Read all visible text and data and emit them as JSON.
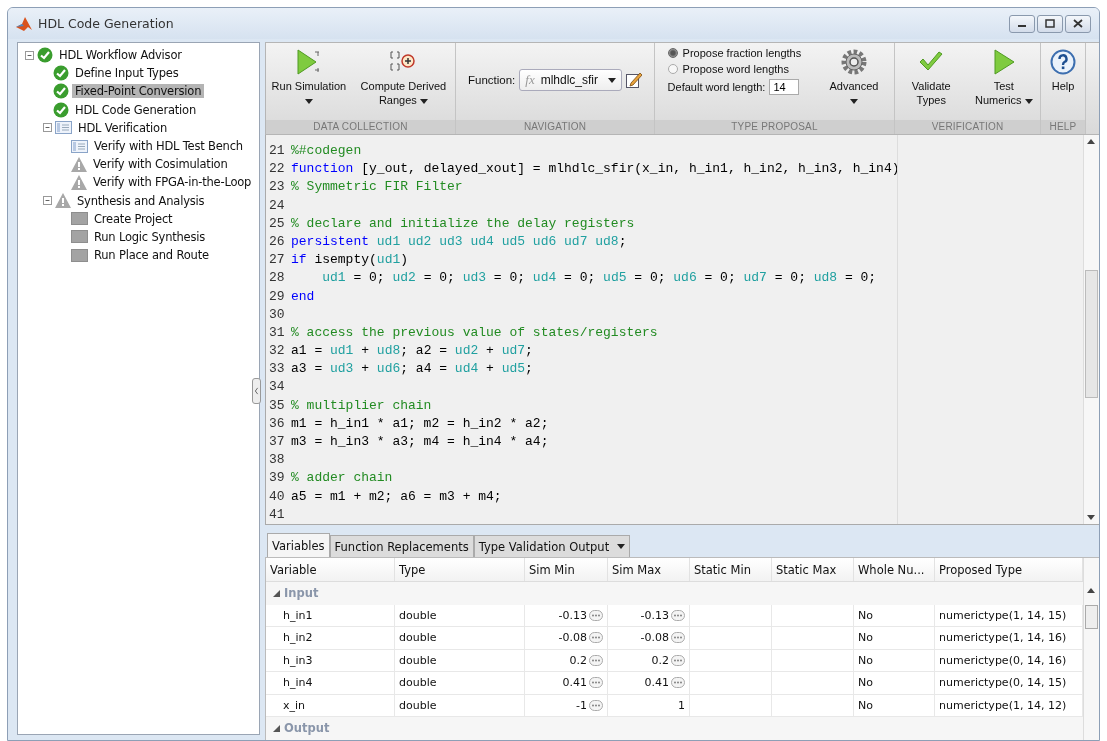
{
  "window": {
    "title": "HDL Code Generation"
  },
  "workflow_tree": [
    {
      "label": "HDL Workflow Advisor",
      "kind": "passed",
      "selected": false,
      "expanded": true,
      "children": [
        {
          "label": "Define Input Types",
          "kind": "passed",
          "selected": false
        },
        {
          "label": "Fixed-Point Conversion",
          "kind": "passed",
          "selected": true
        },
        {
          "label": "HDL Code Generation",
          "kind": "passed",
          "selected": false
        },
        {
          "label": "HDL Verification",
          "kind": "task-list",
          "selected": false,
          "expanded": true,
          "children": [
            {
              "label": "Verify with HDL Test Bench",
              "kind": "task-list",
              "selected": false
            },
            {
              "label": "Verify with Cosimulation",
              "kind": "warning",
              "selected": false
            },
            {
              "label": "Verify with FPGA-in-the-Loop",
              "kind": "warning",
              "selected": false
            }
          ]
        },
        {
          "label": "Synthesis and Analysis",
          "kind": "warning",
          "selected": false,
          "expanded": true,
          "children": [
            {
              "label": "Create Project",
              "kind": "not-run",
              "selected": false
            },
            {
              "label": "Run Logic Synthesis",
              "kind": "not-run",
              "selected": false
            },
            {
              "label": "Run Place and Route",
              "kind": "not-run",
              "selected": false
            }
          ]
        }
      ]
    }
  ],
  "toolstrip": {
    "sections": [
      {
        "kind": "buttons",
        "label": "DATA COLLECTION",
        "buttons": [
          {
            "label": "Run Simulation",
            "menu": true
          },
          {
            "label": "Compute Derived Ranges",
            "menu": true
          }
        ]
      },
      {
        "kind": "navigation",
        "label": "NAVIGATION",
        "field_label": "Function:",
        "prefix": "fx",
        "value": "mlhdlc_sfir"
      },
      {
        "kind": "type_proposal",
        "label": "TYPE PROPOSAL",
        "radios": [
          {
            "label": "Propose fraction lengths",
            "selected": true
          },
          {
            "label": "Propose word lengths",
            "selected": false
          }
        ],
        "field_label": "Default word length:",
        "value": "14",
        "buttons": [
          {
            "label": "Advanced",
            "menu": true
          }
        ]
      },
      {
        "kind": "buttons",
        "label": "VERIFICATION",
        "buttons": [
          {
            "label": "Validate Types",
            "menu": false
          },
          {
            "label": "Test Numerics",
            "menu": true
          }
        ]
      },
      {
        "kind": "buttons",
        "label": "HELP",
        "buttons": [
          {
            "label": "Help",
            "menu": false
          }
        ]
      }
    ]
  },
  "code": {
    "lines": [
      {
        "number": "21",
        "tokens": [
          {
            "kind": "comment",
            "text": "%#codegen"
          }
        ]
      },
      {
        "number": "22",
        "tokens": [
          {
            "kind": "keyword",
            "text": "function"
          },
          {
            "kind": "plain",
            "text": " [y_out, delayed_xout] = mlhdlc_sfir(x_in, h_in1, h_in2, h_in3, h_in4)"
          }
        ]
      },
      {
        "number": "23",
        "tokens": [
          {
            "kind": "comment",
            "text": "% Symmetric FIR Filter"
          }
        ]
      },
      {
        "number": "24"
      },
      {
        "number": "25",
        "tokens": [
          {
            "kind": "comment",
            "text": "% declare and initialize the delay registers"
          }
        ]
      },
      {
        "number": "26",
        "tokens": [
          {
            "kind": "keyword",
            "text": "persistent"
          },
          {
            "kind": "variable",
            "text": " ud1 ud2 ud3 ud4 ud5 ud6 ud7 ud8"
          },
          {
            "kind": "plain",
            "text": ";"
          }
        ]
      },
      {
        "number": "27",
        "tokens": [
          {
            "kind": "keyword",
            "text": "if"
          },
          {
            "kind": "plain",
            "text": " isempty("
          },
          {
            "kind": "variable",
            "text": "ud1"
          },
          {
            "kind": "plain",
            "text": ")"
          }
        ]
      },
      {
        "number": "28",
        "tokens": [
          {
            "kind": "variable",
            "text": "    ud1"
          },
          {
            "kind": "plain",
            "text": " = 0; "
          },
          {
            "kind": "variable",
            "text": "ud2"
          },
          {
            "kind": "plain",
            "text": " = 0; "
          },
          {
            "kind": "variable",
            "text": "ud3"
          },
          {
            "kind": "plain",
            "text": " = 0; "
          },
          {
            "kind": "variable",
            "text": "ud4"
          },
          {
            "kind": "plain",
            "text": " = 0; "
          },
          {
            "kind": "variable",
            "text": "ud5"
          },
          {
            "kind": "plain",
            "text": " = 0; "
          },
          {
            "kind": "variable",
            "text": "ud6"
          },
          {
            "kind": "plain",
            "text": " = 0; "
          },
          {
            "kind": "variable",
            "text": "ud7"
          },
          {
            "kind": "plain",
            "text": " = 0; "
          },
          {
            "kind": "variable",
            "text": "ud8"
          },
          {
            "kind": "plain",
            "text": " = 0;"
          }
        ]
      },
      {
        "number": "29",
        "tokens": [
          {
            "kind": "keyword",
            "text": "end"
          }
        ]
      },
      {
        "number": "30"
      },
      {
        "number": "31",
        "tokens": [
          {
            "kind": "comment",
            "text": "% access the previous value of states/registers"
          }
        ]
      },
      {
        "number": "32",
        "tokens": [
          {
            "kind": "plain",
            "text": "a1 = "
          },
          {
            "kind": "variable",
            "text": "ud1"
          },
          {
            "kind": "plain",
            "text": " + "
          },
          {
            "kind": "variable",
            "text": "ud8"
          },
          {
            "kind": "plain",
            "text": "; a2 = "
          },
          {
            "kind": "variable",
            "text": "ud2"
          },
          {
            "kind": "plain",
            "text": " + "
          },
          {
            "kind": "variable",
            "text": "ud7"
          },
          {
            "kind": "plain",
            "text": ";"
          }
        ]
      },
      {
        "number": "33",
        "tokens": [
          {
            "kind": "plain",
            "text": "a3 = "
          },
          {
            "kind": "variable",
            "text": "ud3"
          },
          {
            "kind": "plain",
            "text": " + "
          },
          {
            "kind": "variable",
            "text": "ud6"
          },
          {
            "kind": "plain",
            "text": "; a4 = "
          },
          {
            "kind": "variable",
            "text": "ud4"
          },
          {
            "kind": "plain",
            "text": " + "
          },
          {
            "kind": "variable",
            "text": "ud5"
          },
          {
            "kind": "plain",
            "text": ";"
          }
        ]
      },
      {
        "number": "34"
      },
      {
        "number": "35",
        "tokens": [
          {
            "kind": "comment",
            "text": "% multiplier chain"
          }
        ]
      },
      {
        "number": "36",
        "tokens": [
          {
            "kind": "plain",
            "text": "m1 = h_in1 * a1; m2 = h_in2 * a2;"
          }
        ]
      },
      {
        "number": "37",
        "tokens": [
          {
            "kind": "plain",
            "text": "m3 = h_in3 * a3; m4 = h_in4 * a4;"
          }
        ]
      },
      {
        "number": "38"
      },
      {
        "number": "39",
        "tokens": [
          {
            "kind": "comment",
            "text": "% adder chain"
          }
        ]
      },
      {
        "number": "40",
        "tokens": [
          {
            "kind": "plain",
            "text": "a5 = m1 + m2; a6 = m3 + m4;"
          }
        ]
      },
      {
        "number": "41"
      }
    ]
  },
  "variables_panel": {
    "tabs": [
      {
        "label": "Variables",
        "selected": true,
        "menu": false
      },
      {
        "label": "Function Replacements",
        "selected": false,
        "menu": false
      },
      {
        "label": "Type Validation Output",
        "selected": false,
        "menu": true
      }
    ],
    "columns": [
      "Variable",
      "Type",
      "Sim Min",
      "Sim Max",
      "Static Min",
      "Static Max",
      "Whole Nu...",
      "Proposed Type"
    ],
    "groups": [
      {
        "label": "Input",
        "expanded": true,
        "rows": [
          {
            "variable": "h_in1",
            "type": "double",
            "sim_min": "-0.13",
            "sim_min_editable": true,
            "sim_max": "-0.13",
            "sim_max_editable": true,
            "whole_number": "No",
            "proposed_type": "numerictype(1, 14, 15)"
          },
          {
            "variable": "h_in2",
            "type": "double",
            "sim_min": "-0.08",
            "sim_min_editable": true,
            "sim_max": "-0.08",
            "sim_max_editable": true,
            "whole_number": "No",
            "proposed_type": "numerictype(1, 14, 16)"
          },
          {
            "variable": "h_in3",
            "type": "double",
            "sim_min": "0.2",
            "sim_min_editable": true,
            "sim_max": "0.2",
            "sim_max_editable": true,
            "whole_number": "No",
            "proposed_type": "numerictype(0, 14, 16)"
          },
          {
            "variable": "h_in4",
            "type": "double",
            "sim_min": "0.41",
            "sim_min_editable": true,
            "sim_max": "0.41",
            "sim_max_editable": true,
            "whole_number": "No",
            "proposed_type": "numerictype(0, 14, 15)"
          },
          {
            "variable": "x_in",
            "type": "double",
            "sim_min": "-1",
            "sim_min_editable": true,
            "sim_max": "1",
            "sim_max_editable": false,
            "whole_number": "No",
            "proposed_type": "numerictype(1, 14, 12)"
          }
        ]
      },
      {
        "label": "Output",
        "expanded": true
      }
    ]
  }
}
